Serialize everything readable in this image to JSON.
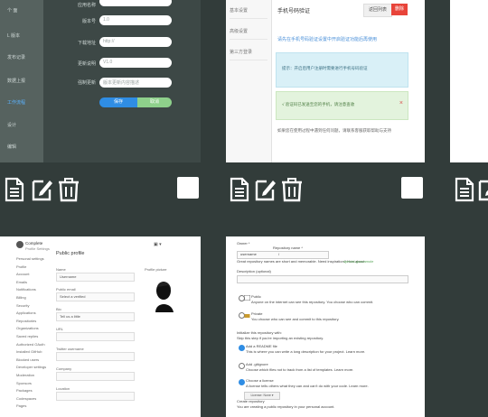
{
  "tile1": {
    "sidebar": [
      "个 面",
      "L 版本",
      "发布记录",
      "数据上报",
      "工作流程",
      "设计",
      "编辑"
    ],
    "sidebar_active": 5,
    "labels": [
      "应用名称",
      "版本号",
      "下载地址",
      "更新说明",
      "强制更新"
    ],
    "fields": [
      "",
      "1.0",
      "http://",
      "V1.0",
      "版本更新内容描述"
    ],
    "btn_primary": "保存",
    "btn_secondary": "取消"
  },
  "tile2": {
    "tabs": [
      "基本设置",
      "高级设置",
      "第三方登录"
    ],
    "title": "手机号码验证",
    "btn_default": "返回列表",
    "btn_danger": "删除",
    "link_text": "请先在手机号码验证设置中开启验证功能后再使用",
    "info_text": "提示：开启后用户注册时需要进行手机号码验证",
    "success_text": "√ 验证码已发送至您的手机，请注意查收",
    "close": "×",
    "footer": "如果您在使用过程中遇到任何问题，请联系客服获取帮助与支持"
  },
  "tile4": {
    "header": "Complete",
    "header_sub": "Profile Settings",
    "title": "Public profile",
    "icon": "▣ ▾",
    "menu": [
      "Personal settings",
      "Profile",
      "Account",
      "Emails",
      "Notifications",
      "Billing",
      "Security",
      "Applications",
      "Repositories",
      "Organizations",
      "Saved replies",
      "Authorized OAuth",
      "Installed GitHub",
      "Blocked users",
      "Developer settings",
      "Moderation",
      "Sponsors",
      "Packages",
      "Codespaces",
      "Pages"
    ],
    "field_labels": [
      "Name",
      "Public email",
      "Bio",
      "URL",
      "Twitter username",
      "Company",
      "Location"
    ],
    "field_values": [
      "Username",
      "Select a verified",
      "Tell us a little",
      "",
      "",
      "",
      ""
    ],
    "photo_label": "Profile picture"
  },
  "tile5": {
    "rows": [
      "Owner *",
      "Repository name *",
      "Great repository names are short and memorable. Need inspiration? How about",
      "Description (optional)",
      "Public",
      "Anyone on the internet can see this repository. You choose who can commit.",
      "Private",
      "You choose who can see and commit to this repository.",
      "Initialize this repository with:",
      "Skip this step if you're importing an existing repository.",
      "Add a README file",
      "This is where you can write a long description for your project. Learn more.",
      "Add .gitignore",
      "Choose which files not to track from a list of templates. Learn more.",
      "Choose a license",
      "A license tells others what they can and can't do with your code. Learn more.",
      "Create repository",
      "You are creating a public repository in your personal account."
    ],
    "suggestion": "special-guacamole",
    "owner_value": "username",
    "sep": "/",
    "menu_btn": "License: None ▾"
  },
  "colors": {
    "background": "#323c3a",
    "accent_blue": "#2f8de4",
    "accent_green": "#8ed08b",
    "danger": "#e8443a"
  }
}
